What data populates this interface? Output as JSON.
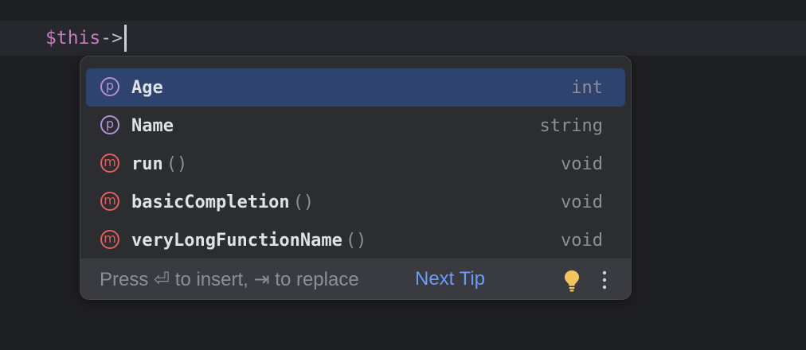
{
  "editor": {
    "code_var": "$this",
    "code_arrow": "->"
  },
  "completion": {
    "items": [
      {
        "kind": "property-icon",
        "kind_letter": "p",
        "name": "Age",
        "parens": "",
        "type": "int",
        "selected": true
      },
      {
        "kind": "property-icon",
        "kind_letter": "p",
        "name": "Name",
        "parens": "",
        "type": "string",
        "selected": false
      },
      {
        "kind": "method-icon",
        "kind_letter": "m",
        "name": "run",
        "parens": "()",
        "type": "void",
        "selected": false
      },
      {
        "kind": "method-icon",
        "kind_letter": "m",
        "name": "basicCompletion",
        "parens": "()",
        "type": "void",
        "selected": false
      },
      {
        "kind": "method-icon",
        "kind_letter": "m",
        "name": "veryLongFunctionName",
        "parens": "()",
        "type": "void",
        "selected": false
      }
    ],
    "footer": {
      "hint": "Press ⏎ to insert, ⇥ to replace",
      "next_tip": "Next Tip",
      "bulb_icon": "lightbulb-icon",
      "more_icon": "more-vertical-icon"
    }
  },
  "colors": {
    "background": "#1e1f22",
    "selection": "#2e436e",
    "property_icon": "#b38fd6",
    "method_icon": "#e05f5f",
    "link": "#6b9bfa",
    "bulb": "#f2c55c"
  }
}
